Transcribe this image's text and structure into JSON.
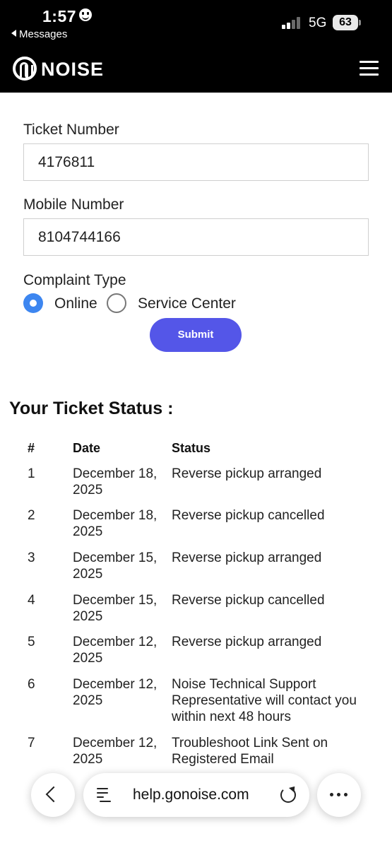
{
  "status_bar": {
    "time": "1:57",
    "back_app": "Messages",
    "network": "5G",
    "battery": "63"
  },
  "header": {
    "brand": "NOISE",
    "logo_icon": "noise-logo-icon",
    "menu_icon": "hamburger-menu-icon"
  },
  "form": {
    "ticket_label": "Ticket Number",
    "ticket_value": "4176811",
    "mobile_label": "Mobile Number",
    "mobile_value": "8104744166",
    "complaint_label": "Complaint Type",
    "option_online": "Online",
    "option_service": "Service Center",
    "selected_option": "Online",
    "submit_label": "Submit"
  },
  "status": {
    "title": "Your Ticket Status :",
    "headers": [
      "#",
      "Date",
      "Status"
    ],
    "rows": [
      {
        "num": "1",
        "date": "December 18, 2025",
        "status": "Reverse pickup arranged"
      },
      {
        "num": "2",
        "date": "December 18, 2025",
        "status": "Reverse pickup cancelled"
      },
      {
        "num": "3",
        "date": "December 15, 2025",
        "status": "Reverse pickup arranged"
      },
      {
        "num": "4",
        "date": "December 15, 2025",
        "status": "Reverse pickup cancelled"
      },
      {
        "num": "5",
        "date": "December 12, 2025",
        "status": "Reverse pickup arranged"
      },
      {
        "num": "6",
        "date": "December 12, 2025",
        "status": "Noise Technical Support Representative will contact you within next 48 hours"
      },
      {
        "num": "7",
        "date": "December 12, 2025",
        "status": "Troubleshoot Link Sent on Registered Email"
      }
    ]
  },
  "browser": {
    "url": "help.gonoise.com",
    "back_icon": "chevron-left-icon",
    "reader_icon": "reader-mode-icon",
    "reload_icon": "reload-icon",
    "more_icon": "more-dots-icon"
  },
  "colors": {
    "header_bg": "#000000",
    "accent_radio": "#3d86f0",
    "submit_bg": "#5456e8"
  }
}
